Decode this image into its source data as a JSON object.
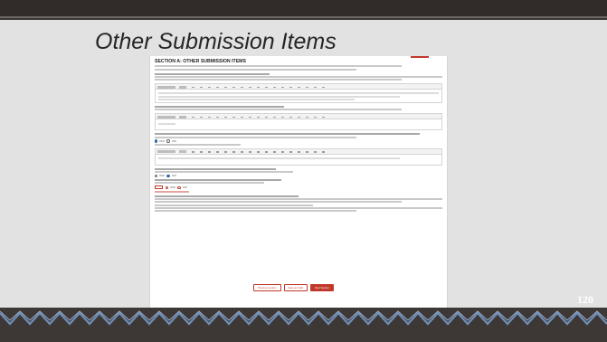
{
  "slide": {
    "title": "Other Submission Items",
    "page_number": "120",
    "colors": {
      "background": "#3b3634",
      "panel": "#e2e2e2",
      "accent": "#c0392b",
      "zigzag": "#6f8fb8"
    }
  },
  "form": {
    "section_title": "SECTION A: OTHER SUBMISSION ITEMS",
    "buttons": {
      "btn_a": "Previous section",
      "btn_b": "Save as draft",
      "btn_c": "Next Section"
    }
  }
}
